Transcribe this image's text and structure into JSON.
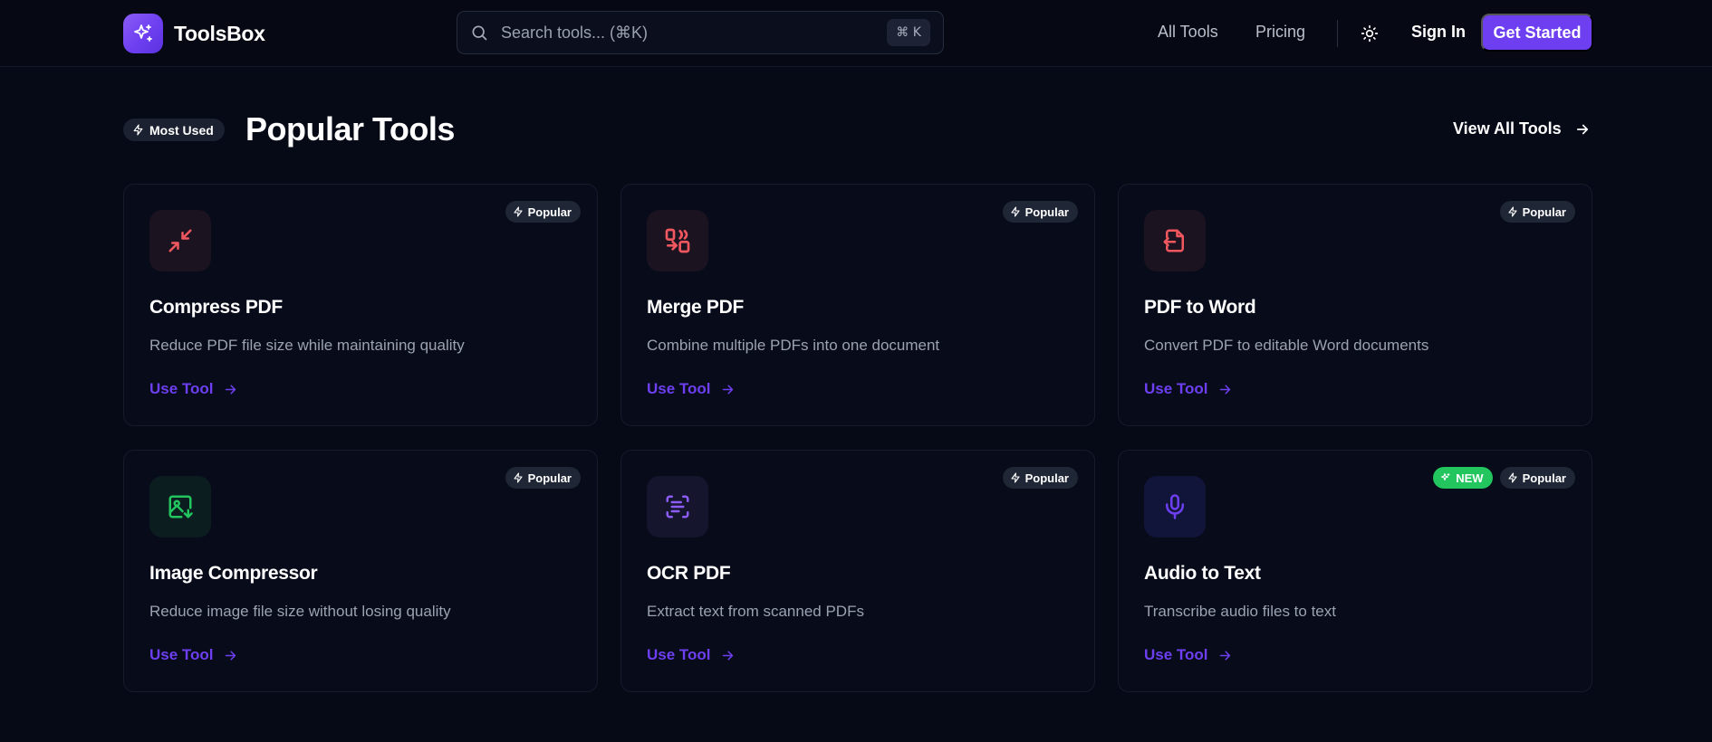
{
  "brand": {
    "name": "ToolsBox"
  },
  "search": {
    "placeholder": "Search tools... (⌘K)",
    "shortcut": "⌘ K"
  },
  "nav": {
    "all_tools": "All Tools",
    "pricing": "Pricing",
    "sign_in": "Sign In",
    "get_started": "Get Started"
  },
  "section": {
    "badge": "Most Used",
    "title": "Popular Tools",
    "view_all": "View All Tools"
  },
  "colors": {
    "accent": "#6d3ff0",
    "new_badge": "#22c55e",
    "background": "#060a17"
  },
  "tools": [
    {
      "title": "Compress PDF",
      "description": "Reduce PDF file size while maintaining quality",
      "action": "Use Tool",
      "tag_popular": "Popular",
      "icon": "compress-icon",
      "icon_color": "#f0575f"
    },
    {
      "title": "Merge PDF",
      "description": "Combine multiple PDFs into one document",
      "action": "Use Tool",
      "tag_popular": "Popular",
      "icon": "merge-icon",
      "icon_color": "#f0575f"
    },
    {
      "title": "PDF to Word",
      "description": "Convert PDF to editable Word documents",
      "action": "Use Tool",
      "tag_popular": "Popular",
      "icon": "file-convert-icon",
      "icon_color": "#f0575f"
    },
    {
      "title": "Image Compressor",
      "description": "Reduce image file size without losing quality",
      "action": "Use Tool",
      "tag_popular": "Popular",
      "icon": "image-download-icon",
      "icon_color": "#22c55e"
    },
    {
      "title": "OCR PDF",
      "description": "Extract text from scanned PDFs",
      "action": "Use Tool",
      "tag_popular": "Popular",
      "icon": "scan-text-icon",
      "icon_color": "#8b5cf6"
    },
    {
      "title": "Audio to Text",
      "description": "Transcribe audio files to text",
      "action": "Use Tool",
      "tag_new": "NEW",
      "tag_popular": "Popular",
      "icon": "microphone-icon",
      "icon_color": "#6d3ff0"
    }
  ]
}
